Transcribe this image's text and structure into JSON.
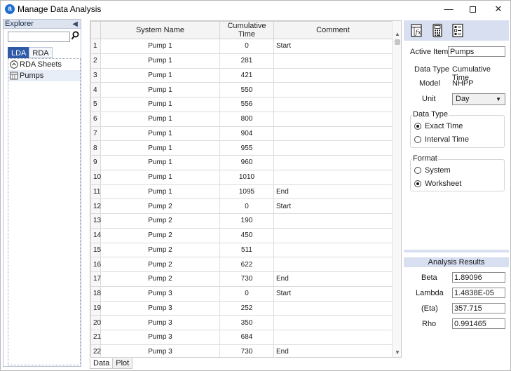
{
  "window": {
    "title": "Manage Data Analysis",
    "app_icon": "a",
    "controls": {
      "minimize": "—",
      "close": "✕"
    }
  },
  "explorer": {
    "title": "Explorer",
    "collapse_glyph": "◀",
    "search": {
      "value": "",
      "placeholder": ""
    },
    "tabs": [
      {
        "label": "LDA",
        "active": true
      },
      {
        "label": "RDA",
        "active": false
      }
    ],
    "tree": [
      {
        "label": "RDA Sheets",
        "icon": "expand-circle-icon"
      },
      {
        "label": "Pumps",
        "icon": "sheet-icon",
        "selected": true
      }
    ]
  },
  "grid": {
    "columns": [
      "",
      "System Name",
      "Cumulative Time",
      "Comment"
    ],
    "rows": [
      {
        "n": "1",
        "system": "Pump 1",
        "time": "0",
        "comment": "Start"
      },
      {
        "n": "2",
        "system": "Pump 1",
        "time": "281",
        "comment": ""
      },
      {
        "n": "3",
        "system": "Pump 1",
        "time": "421",
        "comment": ""
      },
      {
        "n": "4",
        "system": "Pump 1",
        "time": "550",
        "comment": ""
      },
      {
        "n": "5",
        "system": "Pump 1",
        "time": "556",
        "comment": ""
      },
      {
        "n": "6",
        "system": "Pump 1",
        "time": "800",
        "comment": ""
      },
      {
        "n": "7",
        "system": "Pump 1",
        "time": "904",
        "comment": ""
      },
      {
        "n": "8",
        "system": "Pump 1",
        "time": "955",
        "comment": ""
      },
      {
        "n": "9",
        "system": "Pump 1",
        "time": "960",
        "comment": ""
      },
      {
        "n": "10",
        "system": "Pump 1",
        "time": "1010",
        "comment": ""
      },
      {
        "n": "11",
        "system": "Pump 1",
        "time": "1095",
        "comment": "End"
      },
      {
        "n": "12",
        "system": "Pump 2",
        "time": "0",
        "comment": "Start"
      },
      {
        "n": "13",
        "system": "Pump 2",
        "time": "190",
        "comment": ""
      },
      {
        "n": "14",
        "system": "Pump 2",
        "time": "450",
        "comment": ""
      },
      {
        "n": "15",
        "system": "Pump 2",
        "time": "511",
        "comment": ""
      },
      {
        "n": "16",
        "system": "Pump 2",
        "time": "622",
        "comment": ""
      },
      {
        "n": "17",
        "system": "Pump 2",
        "time": "730",
        "comment": "End"
      },
      {
        "n": "18",
        "system": "Pump 3",
        "time": "0",
        "comment": "Start"
      },
      {
        "n": "19",
        "system": "Pump 3",
        "time": "252",
        "comment": ""
      },
      {
        "n": "20",
        "system": "Pump 3",
        "time": "350",
        "comment": ""
      },
      {
        "n": "21",
        "system": "Pump 3",
        "time": "684",
        "comment": ""
      },
      {
        "n": "22",
        "system": "Pump 3",
        "time": "730",
        "comment": "End"
      }
    ]
  },
  "bottom_tabs": [
    {
      "label": "Data",
      "active": true
    },
    {
      "label": "Plot",
      "active": false
    }
  ],
  "panel": {
    "toolbar_icons": [
      "function-sheet-icon",
      "calculator-icon",
      "report-icon"
    ],
    "active_item": {
      "label": "Active Item",
      "value": "Pumps"
    },
    "data_type_label": "Data Type",
    "data_type_value": "Cumulative Time",
    "model_label": "Model",
    "model_value": "NHPP",
    "unit_label": "Unit",
    "unit_value": "Day",
    "data_type_group": {
      "title": "Data Type",
      "options": [
        {
          "label": "Exact Time",
          "selected": true
        },
        {
          "label": "Interval Time",
          "selected": false
        }
      ]
    },
    "format_group": {
      "title": "Format",
      "options": [
        {
          "label": "System",
          "selected": false
        },
        {
          "label": "Worksheet",
          "selected": true
        }
      ]
    },
    "results": {
      "title": "Analysis Results",
      "items": [
        {
          "label": "Beta",
          "value": "1.89096"
        },
        {
          "label": "Lambda",
          "value": "1.4838E-05"
        },
        {
          "label": "(Eta)",
          "value": "357.715"
        },
        {
          "label": "Rho",
          "value": "0.991465"
        }
      ]
    }
  },
  "colors": {
    "accent": "#2e5aa8",
    "panel_band": "#d7dff0",
    "app_icon": "#1f6fd1"
  }
}
